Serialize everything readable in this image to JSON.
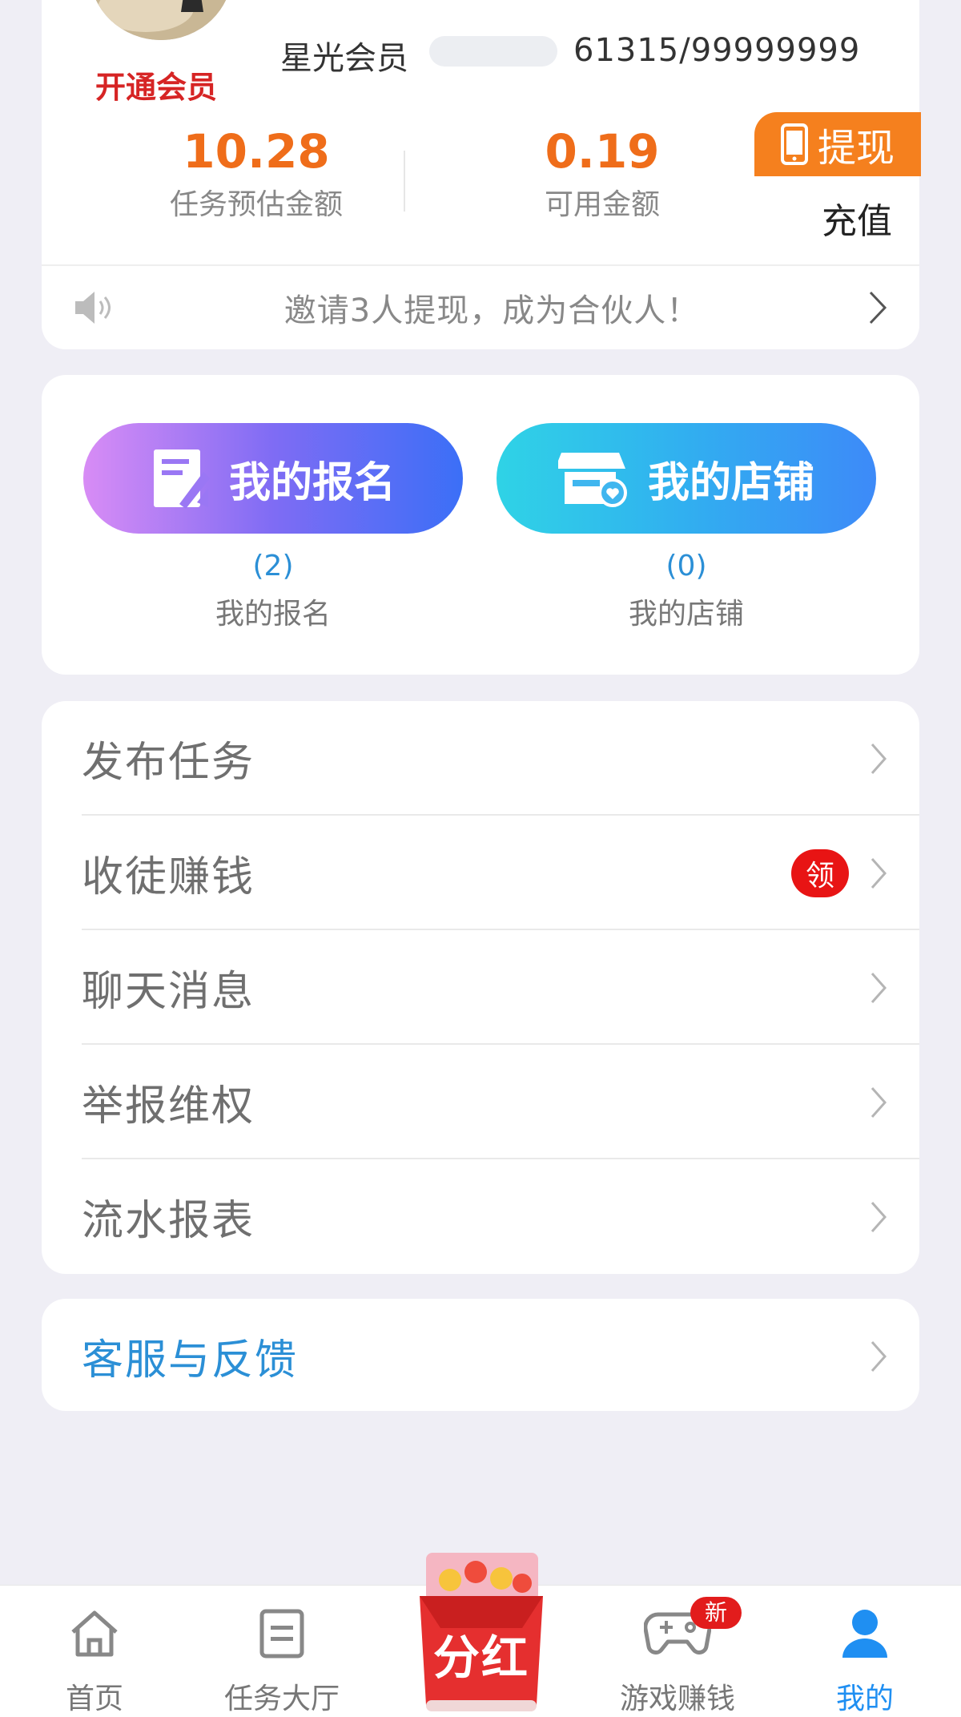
{
  "profile": {
    "vip_link": "开通会员",
    "member_level": "星光会员",
    "member_progress_value": 61315,
    "member_progress_text": "61315/99999999"
  },
  "stats": {
    "estimated_amount": "10.28",
    "estimated_label": "任务预估金额",
    "available_amount": "0.19",
    "available_label": "可用金额"
  },
  "actions": {
    "withdraw_label": "提现",
    "recharge_label": "充值"
  },
  "notice": {
    "text": "邀请3人提现，成为合伙人！"
  },
  "quick_buttons": {
    "signup": {
      "button_label": "我的报名",
      "count": "(2)",
      "label": "我的报名"
    },
    "shop": {
      "button_label": "我的店铺",
      "count": "(0)",
      "label": "我的店铺"
    }
  },
  "menu": [
    {
      "label": "发布任务"
    },
    {
      "label": "收徒赚钱",
      "badge": "领"
    },
    {
      "label": "聊天消息"
    },
    {
      "label": "举报维权"
    },
    {
      "label": "流水报表"
    }
  ],
  "service": {
    "label": "客服与反馈"
  },
  "tabbar": {
    "home": "首页",
    "hall": "任务大厅",
    "dividend": "分红",
    "game": "游戏赚钱",
    "game_badge": "新",
    "me": "我的"
  },
  "colors": {
    "accent_orange": "#ef6d1a",
    "accent_blue": "#1f8ff2",
    "badge_red": "#e81414",
    "vip_red": "#d62424"
  }
}
